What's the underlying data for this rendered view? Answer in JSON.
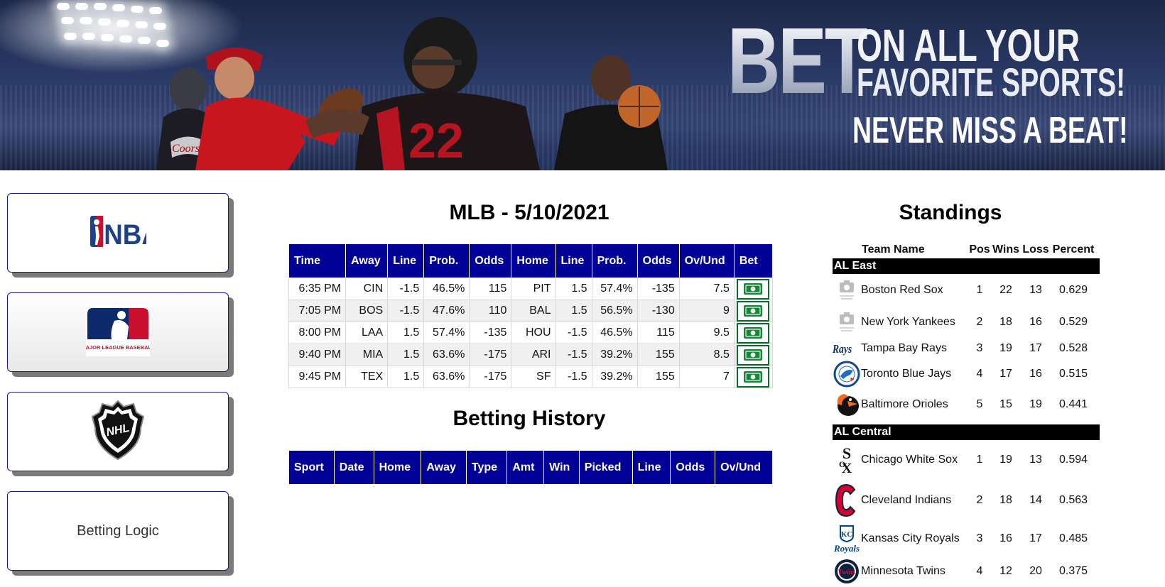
{
  "banner": {
    "headline_bet": "BET",
    "headline_line1": "ON ALL YOUR",
    "headline_line2": "FAVORITE SPORTS!",
    "headline_line3": "NEVER MISS A BEAT!"
  },
  "sidebar": {
    "items": [
      {
        "name": "nba",
        "logo_text": "NBA",
        "icon": "nba-logo-icon"
      },
      {
        "name": "mlb",
        "logo_text": "MAJOR LEAGUE BASEBALL",
        "icon": "mlb-logo-icon"
      },
      {
        "name": "nhl",
        "logo_text": "NHL",
        "icon": "nhl-logo-icon"
      },
      {
        "name": "betting-logic",
        "label": "Betting Logic"
      }
    ]
  },
  "games": {
    "title": "MLB - 5/10/2021",
    "headers": [
      "Time",
      "Away",
      "Line",
      "Prob.",
      "Odds",
      "Home",
      "Line",
      "Prob.",
      "Odds",
      "Ov/Und",
      "Bet"
    ],
    "rows": [
      {
        "time": "6:35 PM",
        "away": "CIN",
        "away_line": "-1.5",
        "away_prob": "46.5%",
        "away_odds": "115",
        "home": "PIT",
        "home_line": "1.5",
        "home_prob": "57.4%",
        "home_odds": "-135",
        "ovund": "7.5"
      },
      {
        "time": "7:05 PM",
        "away": "BOS",
        "away_line": "-1.5",
        "away_prob": "47.6%",
        "away_odds": "110",
        "home": "BAL",
        "home_line": "1.5",
        "home_prob": "56.5%",
        "home_odds": "-130",
        "ovund": "9"
      },
      {
        "time": "8:00 PM",
        "away": "LAA",
        "away_line": "1.5",
        "away_prob": "57.4%",
        "away_odds": "-135",
        "home": "HOU",
        "home_line": "-1.5",
        "home_prob": "46.5%",
        "home_odds": "115",
        "ovund": "9.5"
      },
      {
        "time": "9:40 PM",
        "away": "MIA",
        "away_line": "1.5",
        "away_prob": "63.6%",
        "away_odds": "-175",
        "home": "ARI",
        "home_line": "-1.5",
        "home_prob": "39.2%",
        "home_odds": "155",
        "ovund": "8.5"
      },
      {
        "time": "9:45 PM",
        "away": "TEX",
        "away_line": "1.5",
        "away_prob": "63.6%",
        "away_odds": "-175",
        "home": "SF",
        "home_line": "-1.5",
        "home_prob": "39.2%",
        "home_odds": "155",
        "ovund": "7"
      }
    ]
  },
  "history": {
    "title": "Betting History",
    "headers": [
      "Sport",
      "Date",
      "Home",
      "Away",
      "Type",
      "Amt",
      "Win",
      "Picked",
      "Line",
      "Odds",
      "Ov/Und"
    ]
  },
  "standings": {
    "title": "Standings",
    "headers": {
      "team": "Team Name",
      "pos": "Pos",
      "wins": "Wins",
      "loss": "Loss",
      "pct": "Percent"
    },
    "divisions": [
      {
        "name": "AL East",
        "teams": [
          {
            "team": "Boston Red Sox",
            "pos": "1",
            "wins": "22",
            "loss": "13",
            "pct": "0.629",
            "icon": "image-placeholder-icon"
          },
          {
            "team": "New York Yankees",
            "pos": "2",
            "wins": "18",
            "loss": "16",
            "pct": "0.529",
            "icon": "image-placeholder-icon"
          },
          {
            "team": "Tampa Bay Rays",
            "pos": "3",
            "wins": "19",
            "loss": "17",
            "pct": "0.528",
            "icon": "rays-logo-icon"
          },
          {
            "team": "Toronto Blue Jays",
            "pos": "4",
            "wins": "17",
            "loss": "16",
            "pct": "0.515",
            "icon": "blue-jays-logo-icon"
          },
          {
            "team": "Baltimore Orioles",
            "pos": "5",
            "wins": "15",
            "loss": "19",
            "pct": "0.441",
            "icon": "orioles-logo-icon"
          }
        ]
      },
      {
        "name": "AL Central",
        "teams": [
          {
            "team": "Chicago White Sox",
            "pos": "1",
            "wins": "19",
            "loss": "13",
            "pct": "0.594",
            "icon": "white-sox-logo-icon"
          },
          {
            "team": "Cleveland Indians",
            "pos": "2",
            "wins": "18",
            "loss": "14",
            "pct": "0.563",
            "icon": "indians-logo-icon"
          },
          {
            "team": "Kansas City Royals",
            "pos": "3",
            "wins": "16",
            "loss": "17",
            "pct": "0.485",
            "icon": "royals-logo-icon"
          },
          {
            "team": "Minnesota Twins",
            "pos": "4",
            "wins": "12",
            "loss": "20",
            "pct": "0.375",
            "icon": "twins-logo-icon"
          }
        ]
      }
    ]
  },
  "colors": {
    "table_header": "#000096",
    "bet_green": "#0b6b2a",
    "card_border": "#1a1a8c"
  }
}
